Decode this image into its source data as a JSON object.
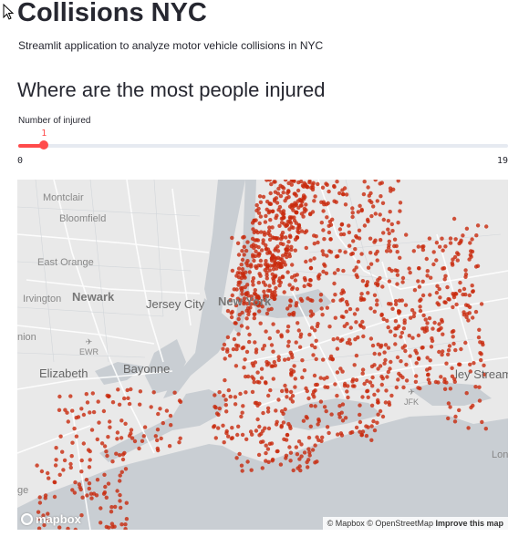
{
  "app": {
    "title": "Collisions NYC",
    "subtitle": "Streamlit application to analyze motor vehicle collisions in NYC",
    "section_heading": "Where are the most people injured"
  },
  "slider": {
    "label": "Number of injured",
    "value": 1,
    "value_text": "1",
    "min": 0,
    "max": 19,
    "min_text": "0",
    "max_text": "19",
    "accent_color": "#ff4b4b"
  },
  "map": {
    "labels": {
      "montclair": "Montclair",
      "bloomfield": "Bloomfield",
      "east_orange": "East Orange",
      "irvington": "Irvington",
      "newark": "Newark",
      "jersey_city": "Jersey City",
      "new_york": "New York",
      "union": "nion",
      "ewr": "EWR",
      "elizabeth": "Elizabeth",
      "bayonne": "Bayonne",
      "valley_stream": "ley Stream",
      "jfk": "JFK",
      "lon": "Lon",
      "ge": "ge"
    },
    "logo_text": "mapbox",
    "attribution": "© Mapbox © OpenStreetMap",
    "improve_link": "Improve this map",
    "point_color": "#c8290c"
  }
}
